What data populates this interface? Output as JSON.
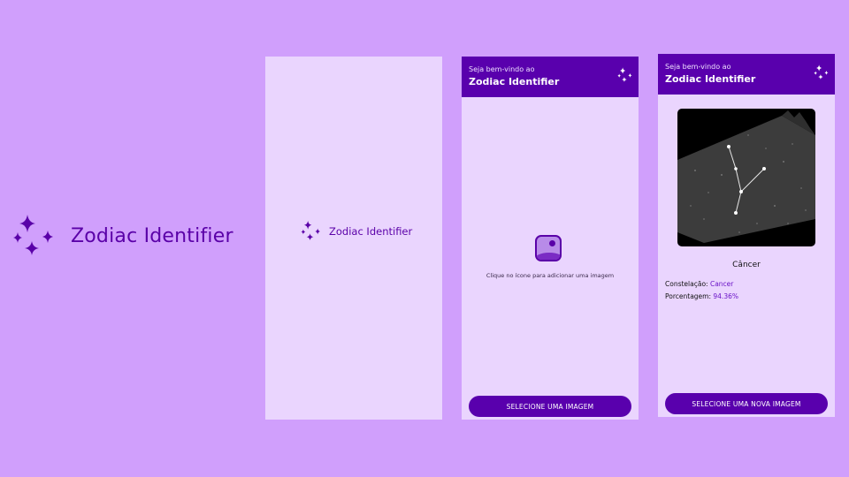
{
  "brand": {
    "name": "Zodiac Identifier",
    "icon": "sparkles-icon"
  },
  "colors": {
    "background": "#d09ffc",
    "screen": "#ead5fe",
    "primary": "#5900ad",
    "accent": "#6a13c7"
  },
  "splash": {
    "app_name": "Zodiac Identifier"
  },
  "upload": {
    "header_subtitle": "Seja bem-vindo ao",
    "header_title": "Zodiac Identifier",
    "hint": "Clique no ícone para adicionar uma imagem",
    "button": "SELECIONE UMA IMAGEM"
  },
  "result": {
    "header_subtitle": "Seja bem-vindo ao",
    "header_title": "Zodiac Identifier",
    "name": "Câncer",
    "constellation_label": "Constelação:",
    "constellation_value": "Cancer",
    "percentage_label": "Porcentagem:",
    "percentage_value": "94.36%",
    "button": "SELECIONE UMA NOVA IMAGEM"
  }
}
